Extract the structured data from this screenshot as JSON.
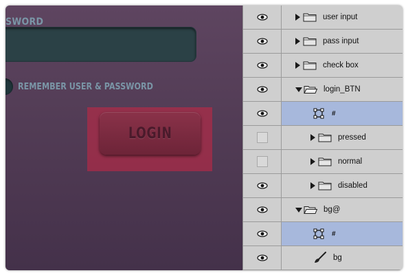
{
  "canvas": {
    "password_label": "SWORD",
    "remember_label": "REMEMBER USER & PASSWORD",
    "login_button_label": "LOGIN"
  },
  "layers": [
    {
      "name": "user input",
      "type": "folder",
      "expanded": false,
      "visible": true,
      "level": 0
    },
    {
      "name": "pass input",
      "type": "folder",
      "expanded": false,
      "visible": true,
      "level": 0
    },
    {
      "name": "check box",
      "type": "folder",
      "expanded": false,
      "visible": true,
      "level": 0
    },
    {
      "name": "login_BTN",
      "type": "folder",
      "expanded": true,
      "visible": true,
      "level": 0
    },
    {
      "name": "#",
      "type": "slice",
      "visible": true,
      "selected": true,
      "level": 1
    },
    {
      "name": "pressed",
      "type": "folder",
      "expanded": false,
      "visible": false,
      "level": 1
    },
    {
      "name": "normal",
      "type": "folder",
      "expanded": false,
      "visible": false,
      "level": 1
    },
    {
      "name": "disabled",
      "type": "folder",
      "expanded": false,
      "visible": true,
      "level": 1
    },
    {
      "name": "bg@",
      "type": "folder",
      "expanded": true,
      "visible": true,
      "level": 0
    },
    {
      "name": "#",
      "type": "slice",
      "visible": true,
      "selected": true,
      "level": 1
    },
    {
      "name": "bg",
      "type": "brush",
      "visible": true,
      "level": 1
    }
  ],
  "colors": {
    "selected_row": "#a7b8dc",
    "highlight": "#be2846",
    "canvas_bg": "#523c55",
    "label_text": "#7a95a6"
  }
}
